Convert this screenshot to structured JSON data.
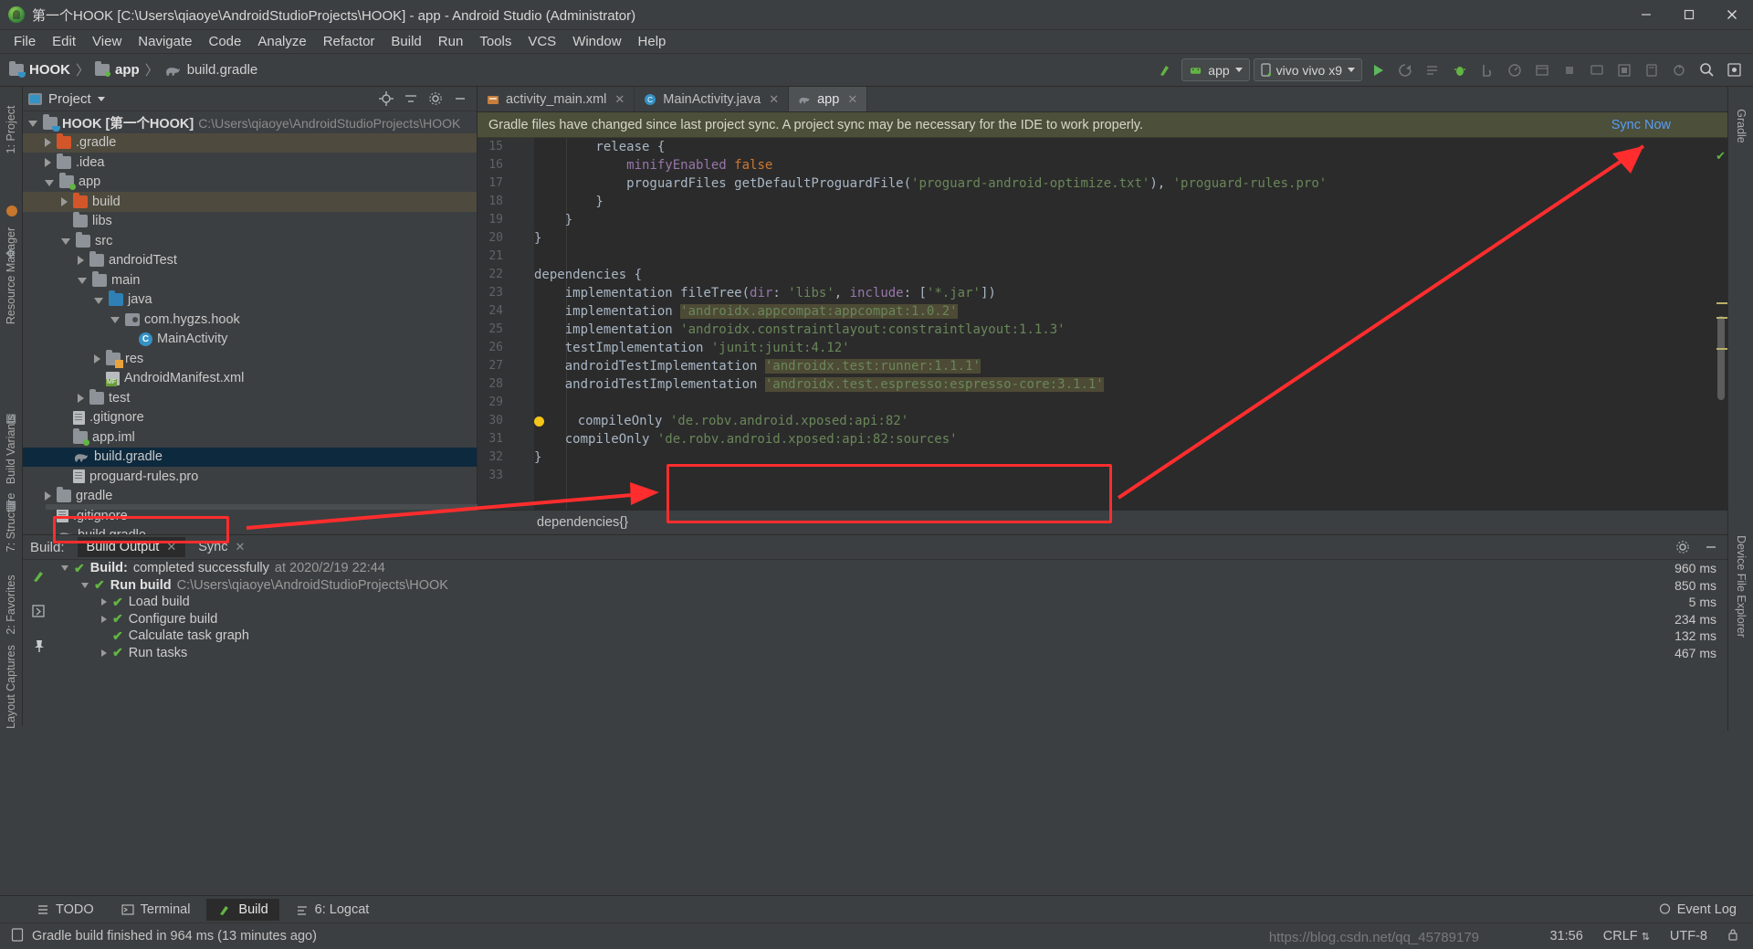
{
  "window": {
    "title": "第一个HOOK [C:\\Users\\qiaoye\\AndroidStudioProjects\\HOOK] - app - Android Studio (Administrator)",
    "minimize": "−",
    "maximize": "□",
    "close": "✕"
  },
  "menu": [
    "File",
    "Edit",
    "View",
    "Navigate",
    "Code",
    "Analyze",
    "Refactor",
    "Build",
    "Run",
    "Tools",
    "VCS",
    "Window",
    "Help"
  ],
  "toolbar": {
    "breadcrumbs": [
      {
        "label": "HOOK",
        "icon": "folder-cup-icon",
        "bold": true
      },
      {
        "label": "app",
        "icon": "folder-green-dot-icon",
        "bold": true
      },
      {
        "label": "build.gradle",
        "icon": "gradle-elephant-icon",
        "bold": false
      }
    ],
    "separator": "〉",
    "module_selector": "app",
    "device_selector": "vivo vivo x9",
    "icons": [
      "make-project-icon",
      "run-icon",
      "apply-changes-icon",
      "apply-code-changes-icon",
      "debug-icon",
      "attach-debugger-icon",
      "profile-icon",
      "sdk-manager-icon",
      "stop-icon",
      "avd-manager-icon",
      "layout-inspector-icon",
      "device-file-explorer-icon",
      "sync-gradle-icon",
      "search-icon",
      "settings-icon"
    ]
  },
  "left_strip": [
    "1: Project",
    "Resource Manager",
    "Build Variants",
    "7: Structure",
    "2: Favorites",
    "Layout Captures"
  ],
  "right_strip": [
    "Gradle",
    "Device File Explorer"
  ],
  "project_panel": {
    "title": "Project",
    "tree": [
      {
        "depth": 0,
        "arrow": "down",
        "icon": "folder-cup-icon",
        "label": "HOOK [第一个HOOK]",
        "bold": true,
        "path": "C:\\Users\\qiaoye\\AndroidStudioProjects\\HOOK",
        "state": "none"
      },
      {
        "depth": 1,
        "arrow": "right",
        "icon": "folder-orange-icon",
        "label": ".gradle",
        "state": "tan"
      },
      {
        "depth": 1,
        "arrow": "right",
        "icon": "folder-icon",
        "label": ".idea",
        "state": "none"
      },
      {
        "depth": 1,
        "arrow": "down",
        "icon": "folder-green-dot-icon",
        "label": "app",
        "state": "none"
      },
      {
        "depth": 2,
        "arrow": "right",
        "icon": "folder-orange-icon",
        "label": "build",
        "state": "tan"
      },
      {
        "depth": 2,
        "arrow": "none",
        "icon": "folder-icon",
        "label": "libs",
        "state": "none"
      },
      {
        "depth": 2,
        "arrow": "down",
        "icon": "folder-icon",
        "label": "src",
        "state": "none"
      },
      {
        "depth": 3,
        "arrow": "right",
        "icon": "folder-icon",
        "label": "androidTest",
        "state": "none"
      },
      {
        "depth": 3,
        "arrow": "down",
        "icon": "folder-icon",
        "label": "main",
        "state": "none"
      },
      {
        "depth": 4,
        "arrow": "down",
        "icon": "folder-blue-icon",
        "label": "java",
        "state": "none"
      },
      {
        "depth": 5,
        "arrow": "down",
        "icon": "package-icon",
        "label": "com.hygzs.hook",
        "state": "none"
      },
      {
        "depth": 6,
        "arrow": "none",
        "icon": "class-icon",
        "label": "MainActivity",
        "state": "none"
      },
      {
        "depth": 4,
        "arrow": "right",
        "icon": "folder-res-icon",
        "label": "res",
        "state": "none"
      },
      {
        "depth": 4,
        "arrow": "none",
        "icon": "manifest-icon",
        "label": "AndroidManifest.xml",
        "state": "none"
      },
      {
        "depth": 3,
        "arrow": "right",
        "icon": "folder-icon",
        "label": "test",
        "state": "none"
      },
      {
        "depth": 2,
        "arrow": "none",
        "icon": "file-icon",
        "label": ".gitignore",
        "state": "none"
      },
      {
        "depth": 2,
        "arrow": "none",
        "icon": "folder-green-dot-icon",
        "label": "app.iml",
        "state": "none"
      },
      {
        "depth": 2,
        "arrow": "none",
        "icon": "gradle-elephant-icon",
        "label": "build.gradle",
        "state": "blue"
      },
      {
        "depth": 2,
        "arrow": "none",
        "icon": "file-icon",
        "label": "proguard-rules.pro",
        "state": "none"
      },
      {
        "depth": 1,
        "arrow": "right",
        "icon": "folder-icon",
        "label": "gradle",
        "state": "none"
      },
      {
        "depth": 1,
        "arrow": "none",
        "icon": "file-icon",
        "label": ".gitignore",
        "state": "none"
      },
      {
        "depth": 1,
        "arrow": "none",
        "icon": "gradle-elephant-icon",
        "label": "build.gradle",
        "state": "none"
      }
    ]
  },
  "editor": {
    "tabs": [
      {
        "label": "activity_main.xml",
        "icon": "xml-layout-icon",
        "active": false,
        "closable": true
      },
      {
        "label": "MainActivity.java",
        "icon": "java-class-icon",
        "active": false,
        "closable": true
      },
      {
        "label": "app",
        "icon": "gradle-elephant-icon",
        "active": true,
        "closable": true
      }
    ],
    "notification": {
      "message": "Gradle files have changed since last project sync. A project sync may be necessary for the IDE to work properly.",
      "action": "Sync Now"
    },
    "first_line_number": 15,
    "lines": [
      {
        "n": 15,
        "fold": "top",
        "segments": [
          {
            "t": "        release {",
            "c": "nmd"
          }
        ]
      },
      {
        "n": 16,
        "fold": "",
        "segments": [
          {
            "t": "            ",
            "c": "nmd"
          },
          {
            "t": "minifyEnabled ",
            "c": "pur"
          },
          {
            "t": "false",
            "c": "kw"
          }
        ]
      },
      {
        "n": 17,
        "fold": "",
        "segments": [
          {
            "t": "            proguardFiles getDefaultProguardFile(",
            "c": "nmd"
          },
          {
            "t": "'proguard-android-optimize.txt'",
            "c": "str"
          },
          {
            "t": "), ",
            "c": "nmd"
          },
          {
            "t": "'proguard-rules.pro'",
            "c": "str"
          }
        ]
      },
      {
        "n": 18,
        "fold": "bottom",
        "segments": [
          {
            "t": "        }",
            "c": "nmd"
          }
        ]
      },
      {
        "n": 19,
        "fold": "bottom",
        "segments": [
          {
            "t": "    }",
            "c": "nmd"
          }
        ]
      },
      {
        "n": 20,
        "fold": "bottom",
        "segments": [
          {
            "t": "}",
            "c": "nmd"
          }
        ]
      },
      {
        "n": 21,
        "fold": "",
        "segments": [
          {
            "t": "",
            "c": "nmd"
          }
        ]
      },
      {
        "n": 22,
        "fold": "top",
        "run": true,
        "segments": [
          {
            "t": "dependencies {",
            "c": "nmd"
          }
        ]
      },
      {
        "n": 23,
        "fold": "",
        "segments": [
          {
            "t": "    implementation fileTree(",
            "c": "nmd"
          },
          {
            "t": "dir",
            "c": "pur"
          },
          {
            "t": ": ",
            "c": "nmd"
          },
          {
            "t": "'libs'",
            "c": "str"
          },
          {
            "t": ", ",
            "c": "nmd"
          },
          {
            "t": "include",
            "c": "pur"
          },
          {
            "t": ": [",
            "c": "nmd"
          },
          {
            "t": "'*.jar'",
            "c": "str"
          },
          {
            "t": "])",
            "c": "nmd"
          }
        ]
      },
      {
        "n": 24,
        "fold": "",
        "segments": [
          {
            "t": "    implementation ",
            "c": "nmd"
          },
          {
            "t": "'androidx.appcompat:appcompat:1.0.2'",
            "c": "str hl"
          }
        ]
      },
      {
        "n": 25,
        "fold": "",
        "segments": [
          {
            "t": "    implementation ",
            "c": "nmd"
          },
          {
            "t": "'androidx.constraintlayout:constraintlayout:1.1.3'",
            "c": "str"
          }
        ]
      },
      {
        "n": 26,
        "fold": "",
        "segments": [
          {
            "t": "    testImplementation ",
            "c": "nmd"
          },
          {
            "t": "'junit:junit:4.12'",
            "c": "str"
          }
        ]
      },
      {
        "n": 27,
        "fold": "",
        "segments": [
          {
            "t": "    androidTestImplementation ",
            "c": "nmd"
          },
          {
            "t": "'androidx.test:runner:1.1.1'",
            "c": "str hl"
          }
        ]
      },
      {
        "n": 28,
        "fold": "",
        "segments": [
          {
            "t": "    androidTestImplementation ",
            "c": "nmd"
          },
          {
            "t": "'androidx.test.espresso:espresso-core:3.1.1'",
            "c": "str hl"
          }
        ]
      },
      {
        "n": 29,
        "fold": "",
        "segments": [
          {
            "t": "",
            "c": "nmd"
          }
        ]
      },
      {
        "n": 30,
        "fold": "",
        "bulb": true,
        "segments": [
          {
            "t": "    compileOnly ",
            "c": "nmd"
          },
          {
            "t": "'de.robv.android.xposed:api:82'",
            "c": "str"
          }
        ]
      },
      {
        "n": 31,
        "fold": "",
        "segments": [
          {
            "t": "    compileOnly ",
            "c": "nmd"
          },
          {
            "t": "'de.robv.android.xposed:api:82:sources'",
            "c": "str"
          }
        ]
      },
      {
        "n": 32,
        "fold": "bottom",
        "segments": [
          {
            "t": "}",
            "c": "nmd"
          }
        ]
      },
      {
        "n": 33,
        "fold": "",
        "segments": [
          {
            "t": "",
            "c": "nmd"
          }
        ]
      }
    ],
    "footer_breadcrumb": "dependencies{}"
  },
  "build_panel": {
    "title": "Build:",
    "tabs": [
      {
        "label": "Build Output",
        "active": true,
        "closable": true
      },
      {
        "label": "Sync",
        "active": false,
        "closable": true
      }
    ],
    "rows": [
      {
        "indent": 0,
        "arrow": "down",
        "check": true,
        "strong": "Build:",
        "text": " completed successfully",
        "dim": " at 2020/2/19 22:44",
        "time": "960 ms"
      },
      {
        "indent": 1,
        "arrow": "down",
        "check": true,
        "strong": "Run build",
        "text": "",
        "dim": " C:\\Users\\qiaoye\\AndroidStudioProjects\\HOOK",
        "time": "850 ms"
      },
      {
        "indent": 2,
        "arrow": "right",
        "check": true,
        "strong": "",
        "text": "Load build",
        "dim": "",
        "time": "5 ms"
      },
      {
        "indent": 2,
        "arrow": "right",
        "check": true,
        "strong": "",
        "text": "Configure build",
        "dim": "",
        "time": "234 ms"
      },
      {
        "indent": 2,
        "arrow": "none",
        "check": true,
        "strong": "",
        "text": "Calculate task graph",
        "dim": "",
        "time": "132 ms"
      },
      {
        "indent": 2,
        "arrow": "right",
        "check": true,
        "strong": "",
        "text": "Run tasks",
        "dim": "",
        "time": "467 ms"
      }
    ]
  },
  "bottom_tabs": [
    {
      "label": "TODO",
      "icon": "todo-list-icon",
      "active": false
    },
    {
      "label": "Terminal",
      "icon": "terminal-icon",
      "active": false
    },
    {
      "label": "Build",
      "icon": "build-hammer-icon",
      "active": true
    },
    {
      "label": "6: Logcat",
      "icon": "logcat-icon",
      "active": false
    }
  ],
  "event_log": "Event Log",
  "status": {
    "message": "Gradle build finished in 964 ms (13 minutes ago)",
    "caret": "31:56",
    "line_sep": "CRLF",
    "encoding": "UTF-8",
    "watermark": "https://blog.csdn.net/qq_45789179"
  }
}
